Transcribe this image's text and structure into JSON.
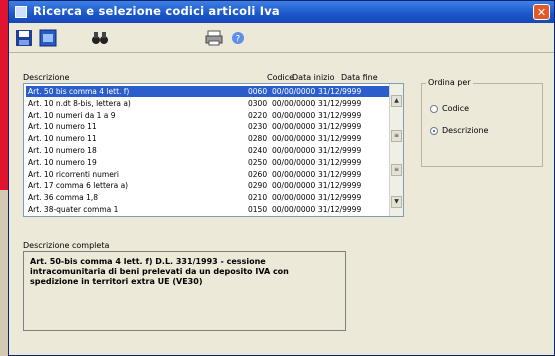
{
  "window": {
    "title": "Ricerca e selezione codici articoli Iva"
  },
  "list": {
    "label": "Descrizione",
    "headers": {
      "code": "Codice",
      "date_start": "Data inizio",
      "date_end": "Data fine"
    },
    "rows": [
      {
        "desc": "Art. 50 bis comma 4 lett. f)",
        "code": "0060",
        "start": "00/00/0000",
        "end": "31/12/9999",
        "selected": true
      },
      {
        "desc": "Art. 10 n.dt 8-bis, lettera a)",
        "code": "0300",
        "start": "00/00/0000",
        "end": "31/12/9999"
      },
      {
        "desc": "Art. 10 numeri da 1 a 9",
        "code": "0220",
        "start": "00/00/0000",
        "end": "31/12/9999"
      },
      {
        "desc": "Art. 10 numero 11",
        "code": "0230",
        "start": "00/00/0000",
        "end": "31/12/9999"
      },
      {
        "desc": "Art. 10 numero 11",
        "code": "0280",
        "start": "00/00/0000",
        "end": "31/12/9999"
      },
      {
        "desc": "Art. 10 numero 18",
        "code": "0240",
        "start": "00/00/0000",
        "end": "31/12/9999"
      },
      {
        "desc": "Art. 10 numero 19",
        "code": "0250",
        "start": "00/00/0000",
        "end": "31/12/9999"
      },
      {
        "desc": "Art. 10 ricorrenti numeri",
        "code": "0260",
        "start": "00/00/0000",
        "end": "31/12/9999"
      },
      {
        "desc": "Art. 17 comma 6 lettera a)",
        "code": "0290",
        "start": "00/00/0000",
        "end": "31/12/9999"
      },
      {
        "desc": "Art. 36 comma 1,8",
        "code": "0210",
        "start": "00/00/0000",
        "end": "31/12/9999"
      },
      {
        "desc": "Art. 38-quater comma 1",
        "code": "0150",
        "start": "00/00/0000",
        "end": "31/12/9999"
      }
    ]
  },
  "sort": {
    "legend": "Ordina per",
    "options": [
      {
        "label": "Codice",
        "checked": false
      },
      {
        "label": "Descrizione",
        "checked": true
      }
    ]
  },
  "details": {
    "label": "Descrizione completa",
    "text": "Art. 50-bis comma 4 lett. f) D.L. 331/1993 - cessione intracomunitaria di beni prelevati da un deposito IVA con spedizione in territori extra UE (VE30)"
  }
}
